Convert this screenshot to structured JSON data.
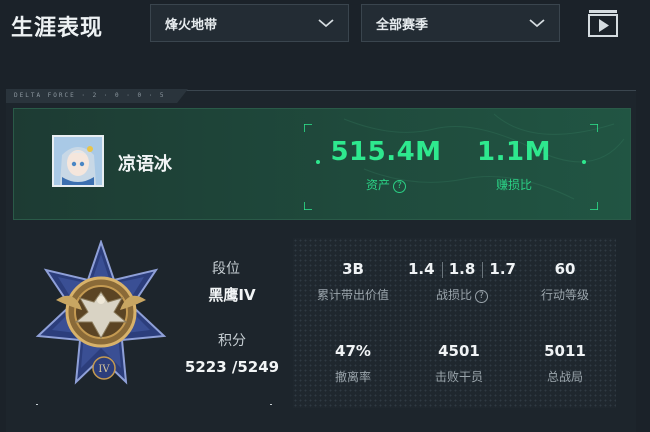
{
  "header": {
    "title": "生涯表现",
    "mode_select": "烽火地带",
    "season_select": "全部赛季"
  },
  "card": {
    "brand_tag": "DELTA FORCE · 2 · 0 · 0 · 5",
    "player_name": "凉语冰",
    "assets_value": "515.4M",
    "assets_label": "资产",
    "profit_ratio_value": "1.1M",
    "profit_ratio_label": "赚损比",
    "rank_label": "段位",
    "rank_value": "黑鹰IV",
    "rank_numeral": "IV",
    "score_label": "积分",
    "score_value": "5223 /5249"
  },
  "stats": {
    "total_value": {
      "value": "3B",
      "label": "累计带出价值"
    },
    "kd": {
      "values": [
        "1.4",
        "1.8",
        "1.7"
      ],
      "label": "战损比"
    },
    "action_level": {
      "value": "60",
      "label": "行动等级"
    },
    "extract_rate": {
      "value": "47%",
      "label": "撤离率"
    },
    "kills": {
      "value": "4501",
      "label": "击败干员"
    },
    "total_matches": {
      "value": "5011",
      "label": "总战局"
    }
  },
  "colors": {
    "accent_green": "#2ee88e",
    "background": "#1b2229",
    "panel_green": "#1f4a3c"
  }
}
